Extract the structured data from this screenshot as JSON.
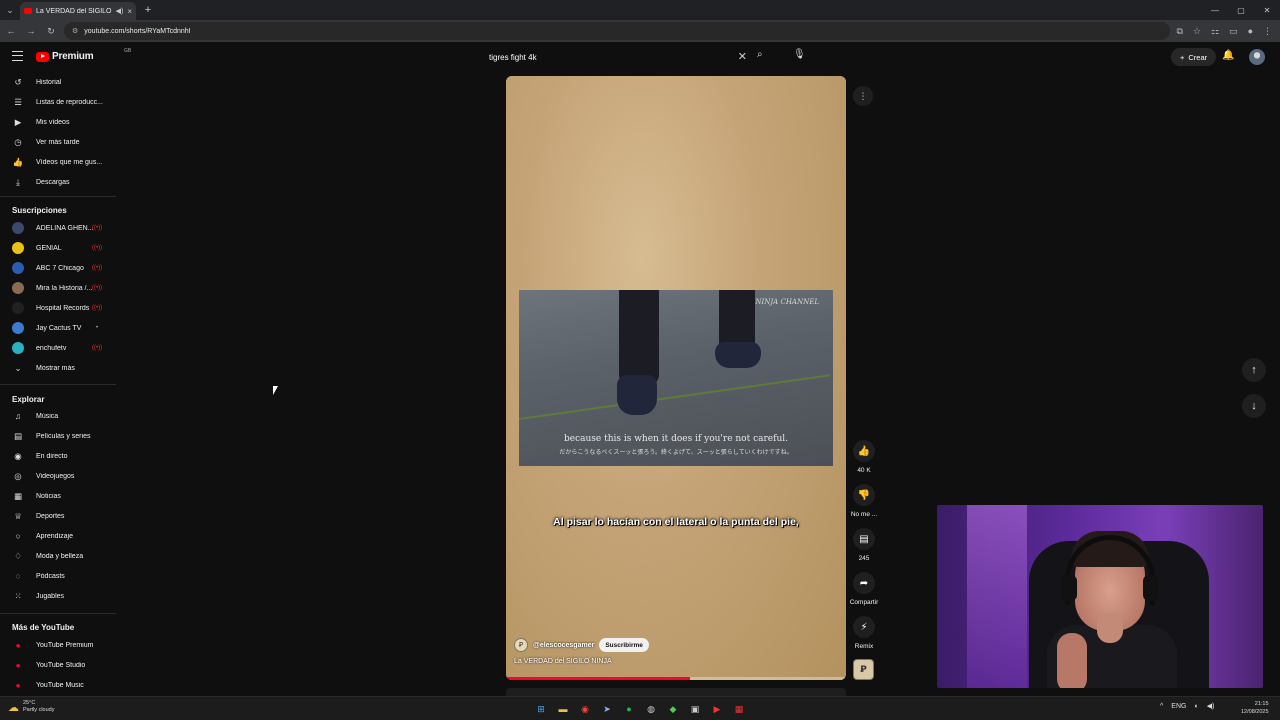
{
  "browser": {
    "tab_title": "La VERDAD del SIGILO NIN",
    "url": "youtube.com/shorts/RYaMTcdnnhI"
  },
  "header": {
    "logo_text": "Premium",
    "logo_sup": "GB",
    "search_value": "tigres fight  4k",
    "create_label": "Crear"
  },
  "sidebar": {
    "you_items": [
      {
        "label": "Historial",
        "icon": "history-icon",
        "glyph": "↺"
      },
      {
        "label": "Listas de reproducc...",
        "icon": "playlist-icon",
        "glyph": "☰"
      },
      {
        "label": "Mis vídeos",
        "icon": "my-videos-icon",
        "glyph": "▶"
      },
      {
        "label": "Ver más tarde",
        "icon": "watch-later-icon",
        "glyph": "◷"
      },
      {
        "label": "Vídeos que me gus...",
        "icon": "liked-icon",
        "glyph": "👍"
      },
      {
        "label": "Descargas",
        "icon": "download-icon",
        "glyph": "⤓"
      }
    ],
    "subs_heading": "Suscripciones",
    "subscriptions": [
      {
        "label": "ADELINA GHEN...",
        "color": "#3a4a6a",
        "live": "((•))"
      },
      {
        "label": "GENIAL",
        "color": "#e8c21a",
        "live": "((•))"
      },
      {
        "label": "ABC 7 Chicago",
        "color": "#2a5db0",
        "live": "((•))"
      },
      {
        "label": "Mira la Historia /...",
        "color": "#8a6a50",
        "live": "((•))"
      },
      {
        "label": "Hospital Records",
        "color": "#222222",
        "live": "((•))"
      },
      {
        "label": "Jay Cactus TV",
        "color": "#3b7bd0",
        "live": "•"
      },
      {
        "label": "enchufetv",
        "color": "#2ab0c0",
        "live": "((•))"
      }
    ],
    "show_more": "Mostrar más",
    "explore_heading": "Explorar",
    "explore_items": [
      {
        "label": "Música",
        "icon": "music-icon",
        "glyph": "♫"
      },
      {
        "label": "Películas y series",
        "icon": "movies-icon",
        "glyph": "▤"
      },
      {
        "label": "En directo",
        "icon": "live-icon",
        "glyph": "◉"
      },
      {
        "label": "Videojuegos",
        "icon": "gaming-icon",
        "glyph": "◎"
      },
      {
        "label": "Noticias",
        "icon": "news-icon",
        "glyph": "▦"
      },
      {
        "label": "Deportes",
        "icon": "trophy-icon",
        "glyph": "♕"
      },
      {
        "label": "Aprendizaje",
        "icon": "lightbulb-icon",
        "glyph": "○"
      },
      {
        "label": "Moda y belleza",
        "icon": "hanger-icon",
        "glyph": "♢"
      },
      {
        "label": "Pódcasts",
        "icon": "podcast-icon",
        "glyph": "◌"
      },
      {
        "label": "Jugables",
        "icon": "playables-icon",
        "glyph": "⁙"
      }
    ],
    "more_heading": "Más de YouTube",
    "more_items": [
      {
        "label": "YouTube Premium",
        "icon": "yt-premium-icon"
      },
      {
        "label": "YouTube Studio",
        "icon": "yt-studio-icon"
      },
      {
        "label": "YouTube Music",
        "icon": "yt-music-icon"
      }
    ]
  },
  "short": {
    "watermark": "NINJA CHANNEL",
    "sub_en": "because this is when it does if you're not careful.",
    "sub_jp": "だからこうなるべくスーッと張ろう。終くよげて、スーッと張らしていくわけですね。",
    "caption": "Al pisar lo hacían con el lateral o la punta del pie,",
    "channel_handle": "@elescocesgamer",
    "subscribe_label": "Suscribirme",
    "title": "La VERDAD del SIGILO NINJA",
    "progress": 0.54
  },
  "actions": {
    "likes": "40 K",
    "dislike": "No me ...",
    "comments": "245",
    "share": "Compartir",
    "remix": "Remix"
  },
  "taskbar": {
    "temp": "25°C",
    "weather": "Partly cloudy",
    "lang": "ENG",
    "time": "21:15",
    "date": "12/08/2025"
  }
}
